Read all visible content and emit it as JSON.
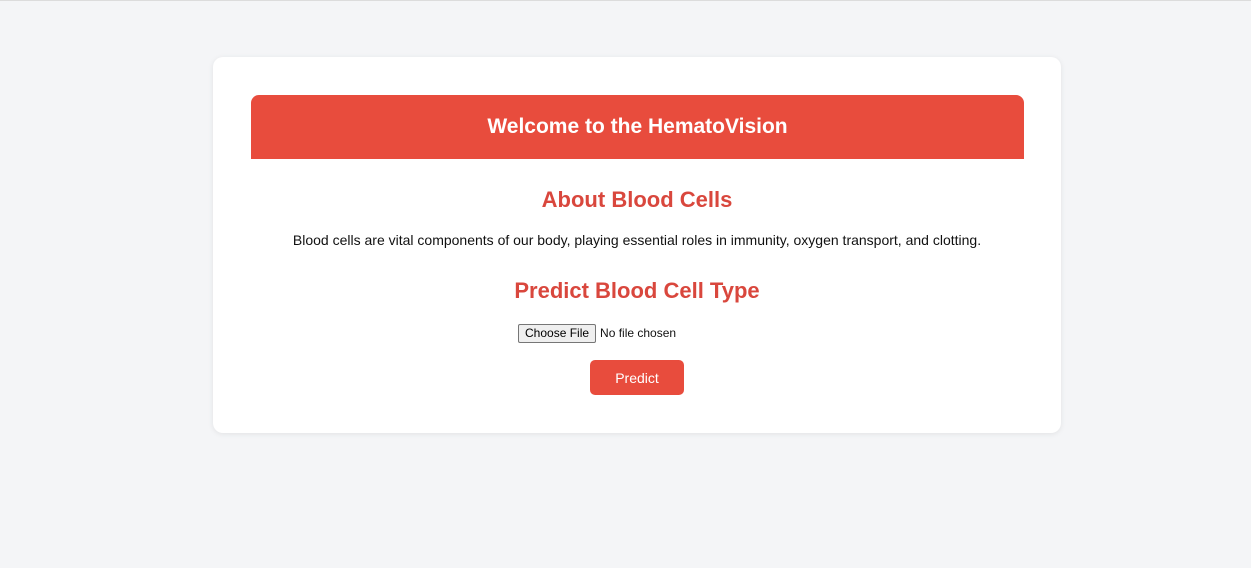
{
  "header": {
    "title": "Welcome to the HematoVision"
  },
  "about": {
    "title": "About Blood Cells",
    "text": "Blood cells are vital components of our body, playing essential roles in immunity, oxygen transport, and clotting."
  },
  "predict": {
    "title": "Predict Blood Cell Type",
    "file_button_label": "Choose File",
    "file_status": "No file chosen",
    "submit_label": "Predict"
  },
  "colors": {
    "accent": "#e84c3d",
    "heading": "#d9473d",
    "background": "#f4f5f7"
  }
}
